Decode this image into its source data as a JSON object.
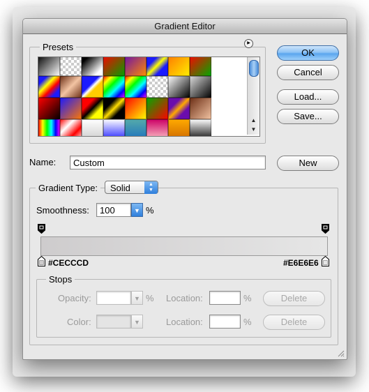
{
  "window": {
    "title": "Gradient Editor"
  },
  "presets": {
    "label": "Presets",
    "swatches": [
      [
        "linear-gradient(135deg,#000,#fff)",
        "trans",
        "linear-gradient(135deg,#000 20%,#fff 80%)",
        "linear-gradient(135deg,#ff0000,#00a000)",
        "linear-gradient(135deg,#6a0dad,#ff8c00)",
        "linear-gradient(135deg,#1a1aff 30%,#ffff00 50%,#1a1aff 70%)",
        "linear-gradient(135deg,#ff7700,#ffee00)",
        "linear-gradient(135deg,#ff0000,#00aa00)"
      ],
      [
        "linear-gradient(135deg,#1a1aff 20%,#ffff00 40%,#ff0000 60%,#1a1aff 80%)",
        "linear-gradient(135deg,#6b2d14,#f3c4a3,#6b2d14)",
        "linear-gradient(135deg,#1a1aff 40%,#fff 50%,#ffcc00 60%)",
        "linear-gradient(135deg,#ff0000,#ffff00,#00ff00,#00ffff,#0000ff,#ff00ff)",
        "linear-gradient(135deg,#ff0000,#ffff00,#00ff00,#00ffff,#0000ff,#ff00ff)",
        "trans",
        "linear-gradient(135deg,#fff,#000)",
        "linear-gradient(135deg,#ddd,#000)"
      ],
      [
        "linear-gradient(135deg,#ff0000,#000)",
        "linear-gradient(135deg,#1a1aff,#ff7700)",
        "linear-gradient(135deg,#ff0000 30%,#000 50%,#ffff00 70%)",
        "linear-gradient(135deg,#000 30%,#ffdd00 50%,#000 70%)",
        "linear-gradient(135deg,#ff0000,#ffff00)",
        "linear-gradient(135deg,#00aa00,#ff0000)",
        "linear-gradient(135deg,#6a0dad 30%,#ffaa00 50%,#6a0dad 70%)",
        "linear-gradient(135deg,#6b2d14,#f3c4a3)"
      ],
      [
        "linear-gradient(90deg,#ff0000,#ffff00,#00ff00,#00ffff,#0000ff,#ff00ff)",
        "linear-gradient(135deg,#ff0000,#fff,#ff0000,#fff)",
        "linear-gradient(180deg,#fff,#ccc)",
        "linear-gradient(180deg,#fff,#1a1aff)",
        "linear-gradient(180deg,#5aa,#1a6fbf)",
        "linear-gradient(180deg,#c06,#fcc)",
        "linear-gradient(180deg,#ffaa00,#c60)",
        "linear-gradient(180deg,#fff,#000)"
      ]
    ]
  },
  "buttons": {
    "ok": "OK",
    "cancel": "Cancel",
    "load": "Load...",
    "save": "Save...",
    "new": "New",
    "delete_opacity": "Delete",
    "delete_color": "Delete"
  },
  "name_field": {
    "label": "Name:",
    "value": "Custom"
  },
  "gradient_type": {
    "label": "Gradient Type:",
    "value": "Solid"
  },
  "smoothness": {
    "label": "Smoothness:",
    "value": "100",
    "unit": "%"
  },
  "gradient": {
    "start_color": "#CECCCD",
    "end_color": "#E6E6E6",
    "start_label": "#CECCCD",
    "end_label": "#E6E6E6"
  },
  "stops": {
    "label": "Stops",
    "opacity_label": "Opacity:",
    "opacity_unit": "%",
    "location_label_1": "Location:",
    "location_unit_1": "%",
    "color_label": "Color:",
    "location_label_2": "Location:",
    "location_unit_2": "%"
  }
}
